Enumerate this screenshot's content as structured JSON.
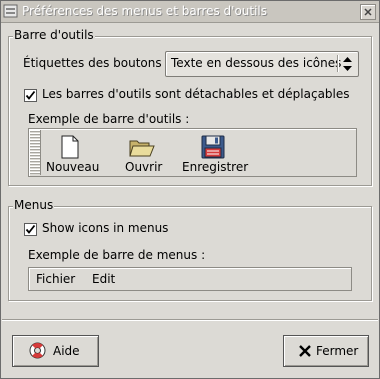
{
  "window": {
    "title": "Préférences des menus et barres d'outils"
  },
  "toolbar_section": {
    "header": "Barre d'outils",
    "button_labels_label": "Étiquettes des boutons :",
    "button_labels_value": "Texte en dessous des icônes",
    "detachable_checkbox": {
      "checked": true,
      "label": "Les barres d'outils sont détachables et déplaçables"
    },
    "example_label": "Exemple de barre d'outils :",
    "example_buttons": [
      {
        "label": "Nouveau",
        "icon": "new-document-icon"
      },
      {
        "label": "Ouvrir",
        "icon": "open-folder-icon"
      },
      {
        "label": "Enregistrer",
        "icon": "save-floppy-icon"
      }
    ]
  },
  "menus_section": {
    "header": "Menus",
    "show_icons_checkbox": {
      "checked": true,
      "label": "Show icons in menus"
    },
    "example_label": "Exemple de barre de menus :",
    "example_menus": [
      "Fichier",
      "Edit"
    ]
  },
  "buttons": {
    "help": {
      "label": "Aide",
      "icon": "help-lifebuoy-icon"
    },
    "close": {
      "label": "Fermer",
      "icon": "close-x-icon"
    }
  }
}
